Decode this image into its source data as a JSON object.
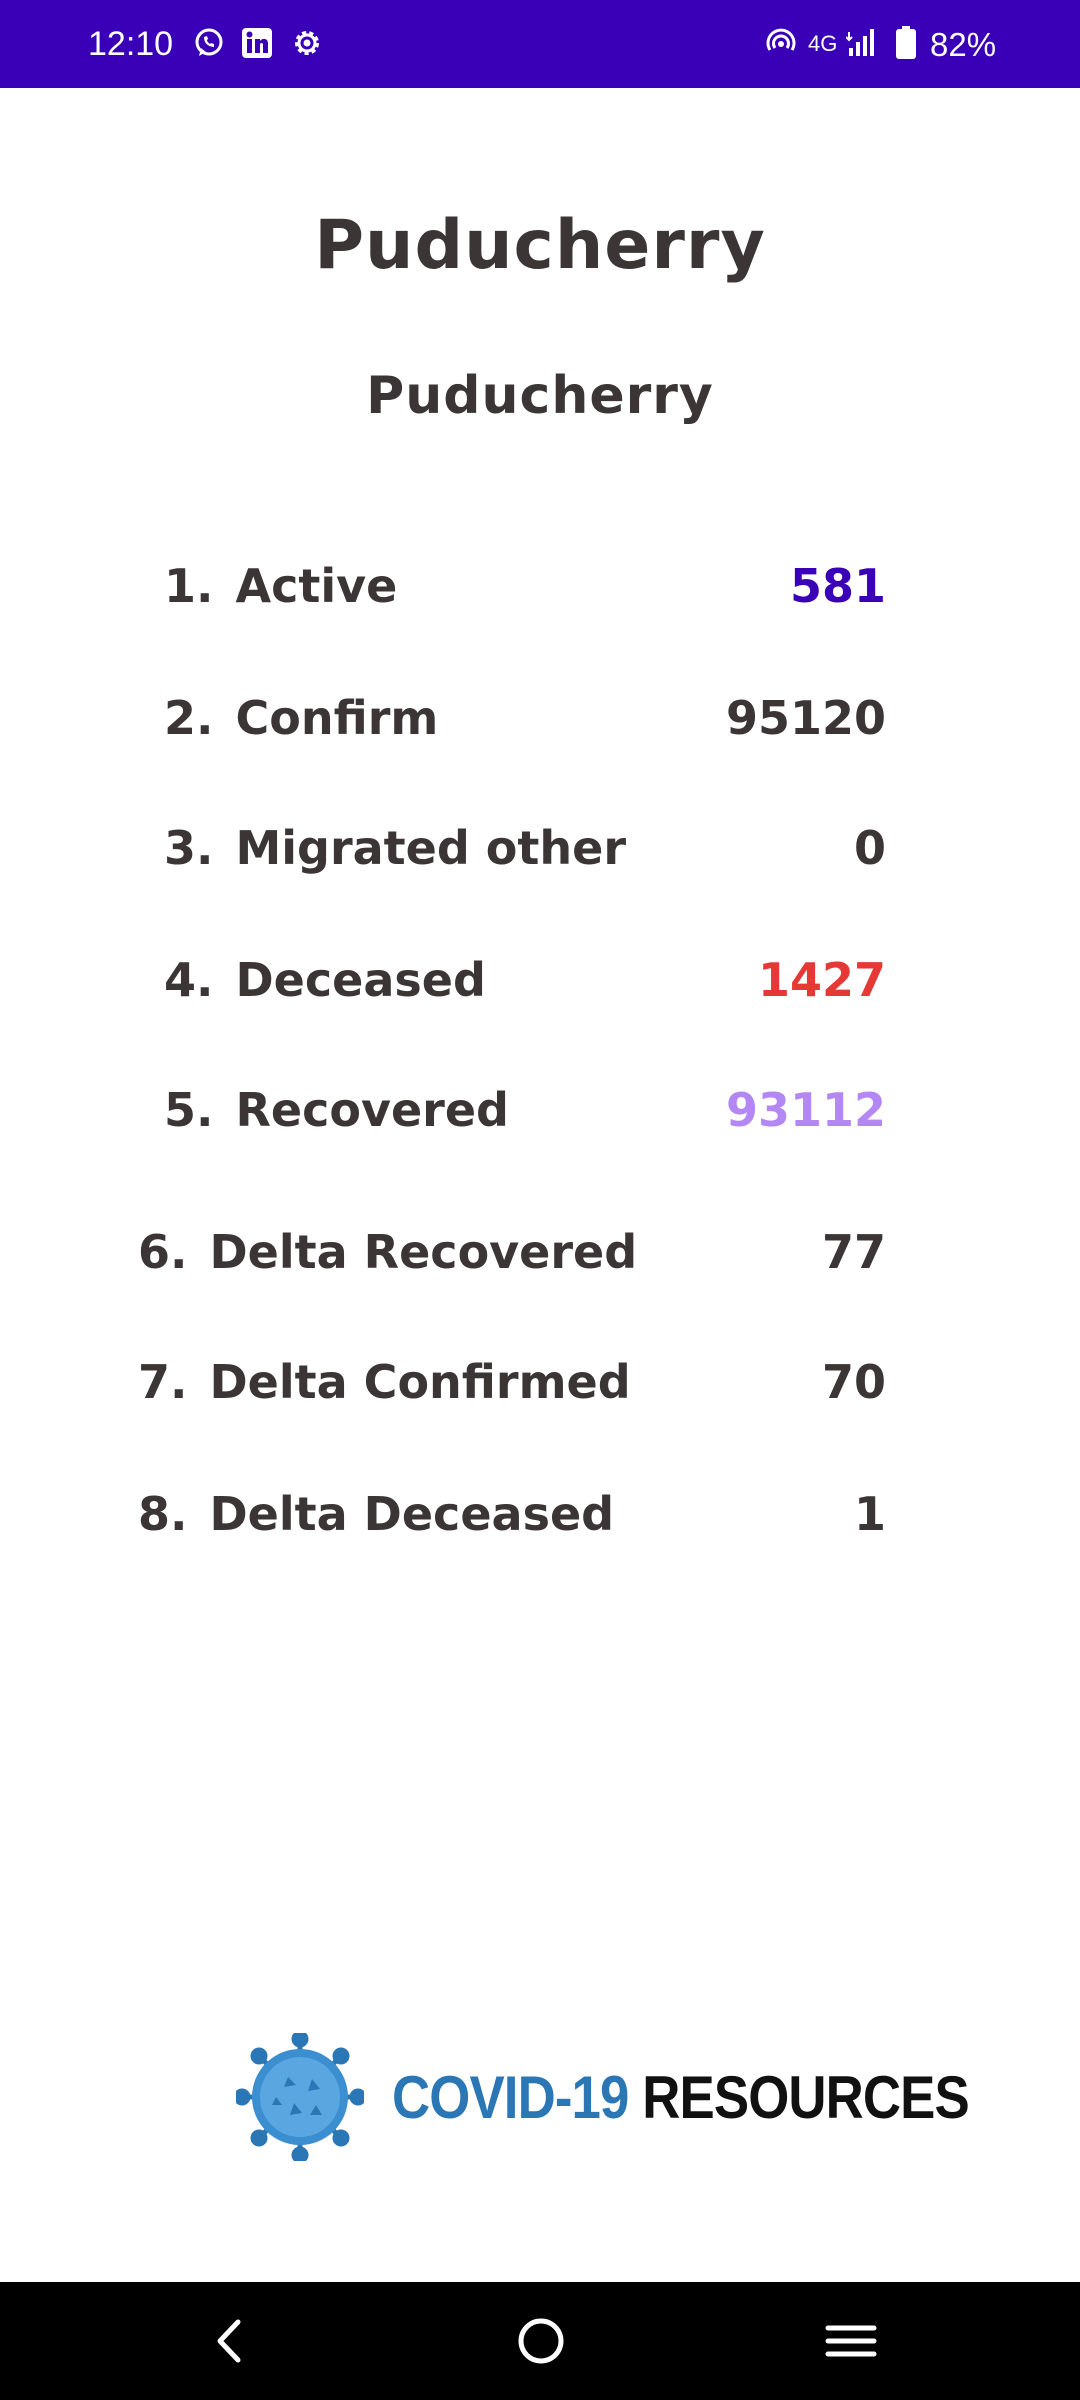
{
  "status_bar": {
    "time": "12:10",
    "network": "4G",
    "battery": "82%",
    "color": "#3a00b8",
    "icons": [
      "whatsapp-icon",
      "linkedin-icon",
      "settings-icon",
      "hotspot-icon",
      "signal-icon",
      "battery-icon"
    ]
  },
  "header": {
    "title": "Puducherry",
    "subtitle": "Puducherry"
  },
  "stats": [
    {
      "num": "1.",
      "label": "Active",
      "value": "581",
      "color": "#3a00b8"
    },
    {
      "num": "2.",
      "label": "Confirm",
      "value": "95120",
      "color": "#3b3535"
    },
    {
      "num": "3.",
      "label": "Migrated other",
      "value": "0",
      "color": "#3b3535"
    },
    {
      "num": "4.",
      "label": "Deceased",
      "value": "1427",
      "color": "#e53935"
    },
    {
      "num": "5.",
      "label": "Recovered",
      "value": "93112",
      "color": "#b388f5"
    },
    {
      "num": "6.",
      "label": "Delta Recovered",
      "value": "77",
      "color": "#3b3535"
    },
    {
      "num": "7.",
      "label": "Delta Confirmed",
      "value": "70",
      "color": "#3b3535"
    },
    {
      "num": "8.",
      "label": "Delta Deceased",
      "value": "1",
      "color": "#3b3535"
    }
  ],
  "footer": {
    "logo_part1": "COVID-19",
    "logo_part2": "RESOURCES",
    "logo_icon": "virus-icon"
  },
  "nav_bar": {
    "buttons": [
      "back-icon",
      "home-icon",
      "menu-icon"
    ]
  }
}
